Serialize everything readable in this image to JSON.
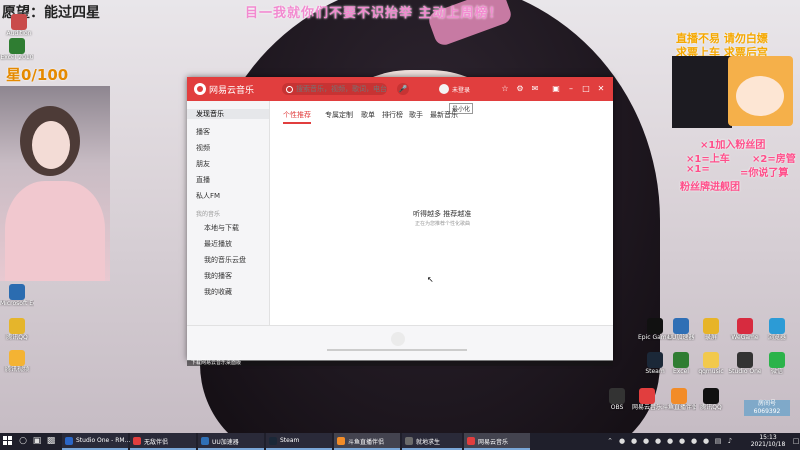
{
  "overlay": {
    "banner": "目一我就你们不要不识抬举 主动上周榜！",
    "wish": "愿望：能过四星",
    "star_progress": "星0/100",
    "right_line1": "直播不易 请勿白嫖",
    "right_line2": "求票上车 求票后宫",
    "rules": [
      "×1加入粉丝团",
      "×1=上车",
      "×2=房管",
      "×1=",
      "=你说了算",
      "粉丝牌进舰团"
    ]
  },
  "desktop_icons_left": [
    {
      "label": "Audition",
      "color": "#c94b4b"
    },
    {
      "label": "Excel 2010",
      "color": "#2f7d32"
    },
    {
      "label": "Microsoft Edge",
      "color": "#2b6cb0"
    },
    {
      "label": "腾讯QQ",
      "color": "#e5b52b"
    },
    {
      "label": "腾讯视频",
      "color": "#f4b333"
    }
  ],
  "desktop_icons_right": [
    {
      "label": "Epic Games",
      "color": "#111111"
    },
    {
      "label": "UU加速器",
      "color": "#2f6fb5"
    },
    {
      "label": "录屏",
      "color": "#e7b428"
    },
    {
      "label": "WeGame",
      "color": "#d72b3f"
    },
    {
      "label": "浏览器",
      "color": "#2c9bd6"
    },
    {
      "label": "Steam",
      "color": "#1b2838"
    },
    {
      "label": "Excel",
      "color": "#2f7d32"
    },
    {
      "label": "qqmusic",
      "color": "#f2c94c"
    },
    {
      "label": "Studio One",
      "color": "#333333"
    },
    {
      "label": "微信",
      "color": "#2bb34a"
    },
    {
      "label": "OBS",
      "color": "#333333"
    },
    {
      "label": "网易云音乐",
      "color": "#e13e3e"
    },
    {
      "label": "斗鱼直播伴侣",
      "color": "#f28c28"
    },
    {
      "label": "腾讯QQ",
      "color": "#111111"
    }
  ],
  "music_window": {
    "app_name": "网易云音乐",
    "search_placeholder": "搜索音乐，视频，歌词，电台",
    "mic": "🎤",
    "login_text": "未登录",
    "tooltip": "最小化",
    "toolbar_icons": [
      "shirt-icon",
      "gear-icon",
      "mail-icon",
      "mini-icon",
      "minimize-icon",
      "maximize-icon",
      "close-icon"
    ],
    "sidebar": {
      "items": [
        "发现音乐",
        "播客",
        "视频",
        "朋友",
        "直播",
        "私人FM"
      ],
      "group_label": "我的音乐",
      "sub_items": [
        "本地与下载",
        "最近播放",
        "我的音乐云盘",
        "我的播客",
        "我的收藏"
      ]
    },
    "tabs": [
      "个性推荐",
      "专属定制",
      "歌单",
      "排行榜",
      "歌手",
      "最新音乐"
    ],
    "empty_title": "听得越多 推荐越准",
    "empty_subtitle": "正在为您推荐个性化歌曲",
    "status_strip": "下载网易云音乐桌面版",
    "progress": 0.0
  },
  "taskbar": {
    "apps": [
      {
        "label": "Studio One - RM...",
        "color": "#2b66c6"
      },
      {
        "label": "无敌伴侣",
        "color": "#e13e3e"
      },
      {
        "label": "UU加速器",
        "color": "#2f6fb5"
      },
      {
        "label": "Steam",
        "color": "#1b2838"
      },
      {
        "label": "斗鱼直播伴侣",
        "color": "#f28c28"
      },
      {
        "label": "就地求生",
        "color": "#6b6b6b"
      },
      {
        "label": "网易云音乐",
        "color": "#e13e3e"
      }
    ],
    "time": "15:13",
    "date": "2021/10/18",
    "streamer_badge": "房间号",
    "room_number": "6069392"
  }
}
